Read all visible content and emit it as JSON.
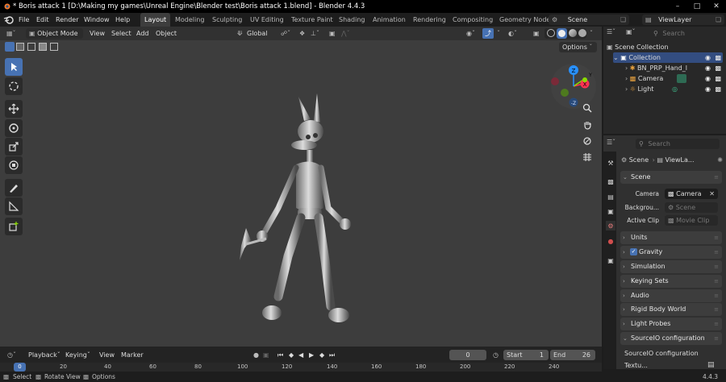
{
  "window": {
    "title": "* Boris attack 1 [D:\\Making my games\\Unreal Engine\\Blender test\\Boris attack 1.blend] - Blender 4.4.3"
  },
  "menus": [
    "File",
    "Edit",
    "Render",
    "Window",
    "Help"
  ],
  "workspaces": [
    "Layout",
    "Modeling",
    "Sculpting",
    "UV Editing",
    "Texture Paint",
    "Shading",
    "Animation",
    "Rendering",
    "Compositing",
    "Geometry Node"
  ],
  "scene_selector": "Scene",
  "viewlayer_selector": "ViewLayer",
  "viewport_header": {
    "mode": "Object Mode",
    "menus": [
      "View",
      "Select",
      "Add",
      "Object"
    ],
    "orientation": "Global",
    "options": "Options"
  },
  "outliner": {
    "search_placeholder": "Search",
    "root": "Scene Collection",
    "collection": "Collection",
    "items": [
      "BN_PRP_Hand_l",
      "Camera",
      "Light"
    ]
  },
  "properties": {
    "search_placeholder": "Search",
    "breadcrumb_scene": "Scene",
    "breadcrumb_layer": "ViewLa...",
    "scene_panel": "Scene",
    "camera_label": "Camera",
    "camera_value": "Camera",
    "background_label": "Backgrou...",
    "background_placeholder": "Scene",
    "active_clip_label": "Active Clip",
    "active_clip_placeholder": "Movie Clip",
    "panels": [
      "Units",
      "Gravity",
      "Simulation",
      "Keying Sets",
      "Audio",
      "Rigid Body World",
      "Light Probes",
      "SourceIO configuration"
    ],
    "gravity_checked": true,
    "sourceio_sub": "SourceIO configuration",
    "texture_partial": "Textu..."
  },
  "gizmo": {
    "x": "X",
    "y": "Y",
    "z": "Z",
    "nz": "-Z"
  },
  "timeline": {
    "menus": [
      "Playback",
      "Keying",
      "View",
      "Marker"
    ],
    "current_frame": "0",
    "start_label": "Start",
    "start": "1",
    "end_label": "End",
    "end": "26",
    "ruler": [
      "0",
      "20",
      "40",
      "60",
      "80",
      "100",
      "120",
      "140",
      "160",
      "180",
      "200",
      "220",
      "240"
    ]
  },
  "statusbar": {
    "select": "Select",
    "rotate": "Rotate View",
    "options": "Options",
    "version": "4.4.3"
  },
  "colors": {
    "accent": "#4772b3",
    "viewport": "#3d3d3d",
    "gizmo_x": "#ff3352",
    "gizmo_y": "#8bdc00",
    "gizmo_z": "#2890ff"
  }
}
